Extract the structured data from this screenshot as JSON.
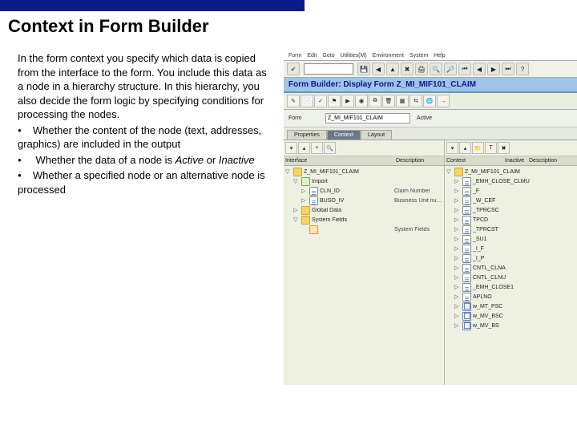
{
  "slide": {
    "title": "Context in Form Builder",
    "para": "In the form context you specify which data is copied from the interface to the form. You include this data as a node in a hierarchy structure. In this hierarchy, you also decide the form logic by specifying conditions for processing the nodes.",
    "b1": "Whether the content of the node (text, addresses, graphics) are included in the output",
    "b2a": "Whether the data of a node is ",
    "b2b": "Active",
    "b2c": " or ",
    "b2d": "Inactive",
    "b3": "Whether a specified node or an alternative node is processed"
  },
  "sap": {
    "menu": [
      "Form",
      "Edit",
      "Goto",
      "Utilities(M)",
      "Environment",
      "System",
      "Help"
    ],
    "header_title": "Form Builder: Display Form Z_MI_MIF101_CLAIM",
    "formrow": {
      "label": "Form",
      "value": "Z_MI_MIF101_CLAIM",
      "active": "Active"
    },
    "tabs": [
      "Properties",
      "Context",
      "Layout"
    ],
    "left": {
      "toolbar_hint": "",
      "hdr": [
        "Interface",
        "Description"
      ],
      "root": "Z_MI_MIF101_CLAIM",
      "nodes": [
        {
          "twist": "▽",
          "icon": "fold",
          "ind": 1,
          "label": "Import",
          "desc": ""
        },
        {
          "twist": "▷",
          "icon": "page",
          "ind": 2,
          "label": "CLN_ID",
          "desc": "Claim Number"
        },
        {
          "twist": "▷",
          "icon": "page",
          "ind": 2,
          "label": "BUSO_IV",
          "desc": "Business Unit number"
        },
        {
          "twist": "▷",
          "icon": "fold",
          "ind": 1,
          "label": "Global Data",
          "desc": ""
        },
        {
          "twist": "▽",
          "icon": "fold",
          "ind": 1,
          "label": "System Fields",
          "desc": ""
        },
        {
          "twist": "",
          "icon": "sys",
          "ind": 2,
          "label": "",
          "desc": "System Fields"
        }
      ]
    },
    "right": {
      "hdr": [
        "Context",
        "Inactive",
        "Description"
      ],
      "root": "Z_MI_MIF101_CLAIM",
      "nodes": [
        {
          "twist": "▷",
          "icon": "page",
          "label": "_EMH_CLOSE_CLMU"
        },
        {
          "twist": "▷",
          "icon": "page",
          "label": "_F"
        },
        {
          "twist": "▷",
          "icon": "page",
          "label": "_W_CEF"
        },
        {
          "twist": "▷",
          "icon": "page",
          "label": "_TPRCSC"
        },
        {
          "twist": "▷",
          "icon": "page",
          "label": "TPCD"
        },
        {
          "twist": "▷",
          "icon": "page",
          "label": "_TPRCST"
        },
        {
          "twist": "▷",
          "icon": "page",
          "label": "_SU1"
        },
        {
          "twist": "▷",
          "icon": "page",
          "label": "_I_F"
        },
        {
          "twist": "▷",
          "icon": "page",
          "label": "_I_P"
        },
        {
          "twist": "▷",
          "icon": "page",
          "label": "CNTL_CLNA"
        },
        {
          "twist": "▷",
          "icon": "page",
          "label": "CNTL_CLNU"
        },
        {
          "twist": "▷",
          "icon": "page",
          "label": "_EMH_CLOSE1"
        },
        {
          "twist": "▷",
          "icon": "page",
          "label": "APLNO"
        },
        {
          "twist": "▷",
          "icon": "table",
          "label": "w_MT_PSC"
        },
        {
          "twist": "▷",
          "icon": "table",
          "label": "w_MV_BSC"
        },
        {
          "twist": "▷",
          "icon": "table",
          "label": "w_MV_BS"
        }
      ]
    }
  }
}
